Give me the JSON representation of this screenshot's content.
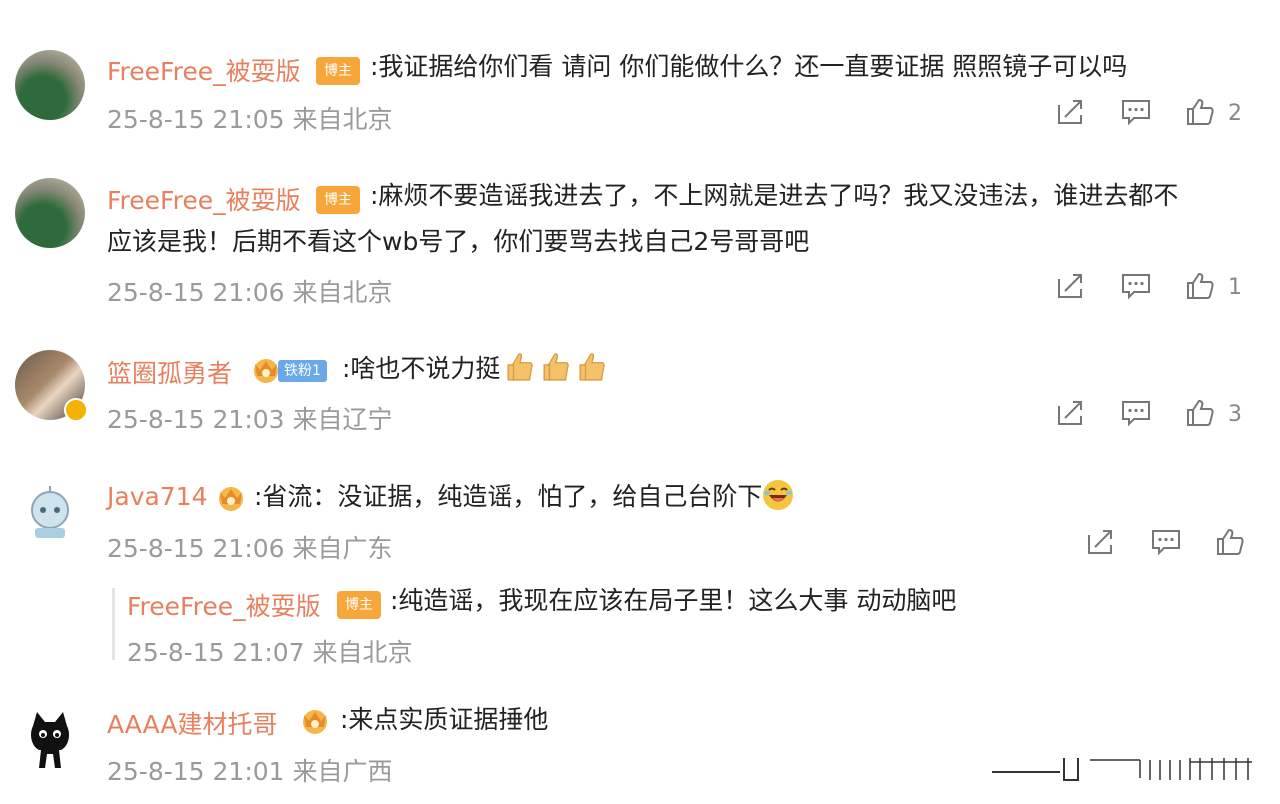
{
  "comments": [
    {
      "user": "FreeFree_被耍版",
      "badge": "博主",
      "text": ":我证据给你们看 请问 你们能做什么？还一直要证据 照照镜子可以吗",
      "meta": "25-8-15 21:05 来自北京",
      "likes": "2"
    },
    {
      "user": "FreeFree_被耍版",
      "badge": "博主",
      "text1": ":麻烦不要造谣我进去了，不上网就是进去了吗？我又没违法，谁进去都不",
      "text2": "应该是我！后期不看这个wb号了，你们要骂去找自己2号哥哥吧",
      "meta": "25-8-15 21:06 来自北京",
      "likes": "1"
    },
    {
      "user": "篮圈孤勇者",
      "fan_badge": "铁粉1",
      "text": ":啥也不说力挺",
      "meta": "25-8-15 21:03 来自辽宁",
      "likes": "3"
    },
    {
      "user": "Java714",
      "text": ":省流：没证据，纯造谣，怕了，给自己台阶下",
      "meta": "25-8-15 21:06 来自广东",
      "reply": {
        "user": "FreeFree_被耍版",
        "badge": "博主",
        "text": ":纯造谣，我现在应该在局子里！这么大事 动动脑吧",
        "meta": "25-8-15 21:07 来自北京"
      }
    },
    {
      "user": "AAAA建材托哥",
      "text": ":来点实质证据捶他",
      "meta": "25-8-15 21:01 来自广西"
    }
  ],
  "icons": [
    "share-icon",
    "comment-icon",
    "like-icon",
    "crown-badge-icon",
    "thumbs-up-emoji",
    "laughing-emoji"
  ],
  "colors": {
    "username": "#e7805f",
    "meta": "#9a9a9a",
    "host_badge": "#f7a63a"
  }
}
